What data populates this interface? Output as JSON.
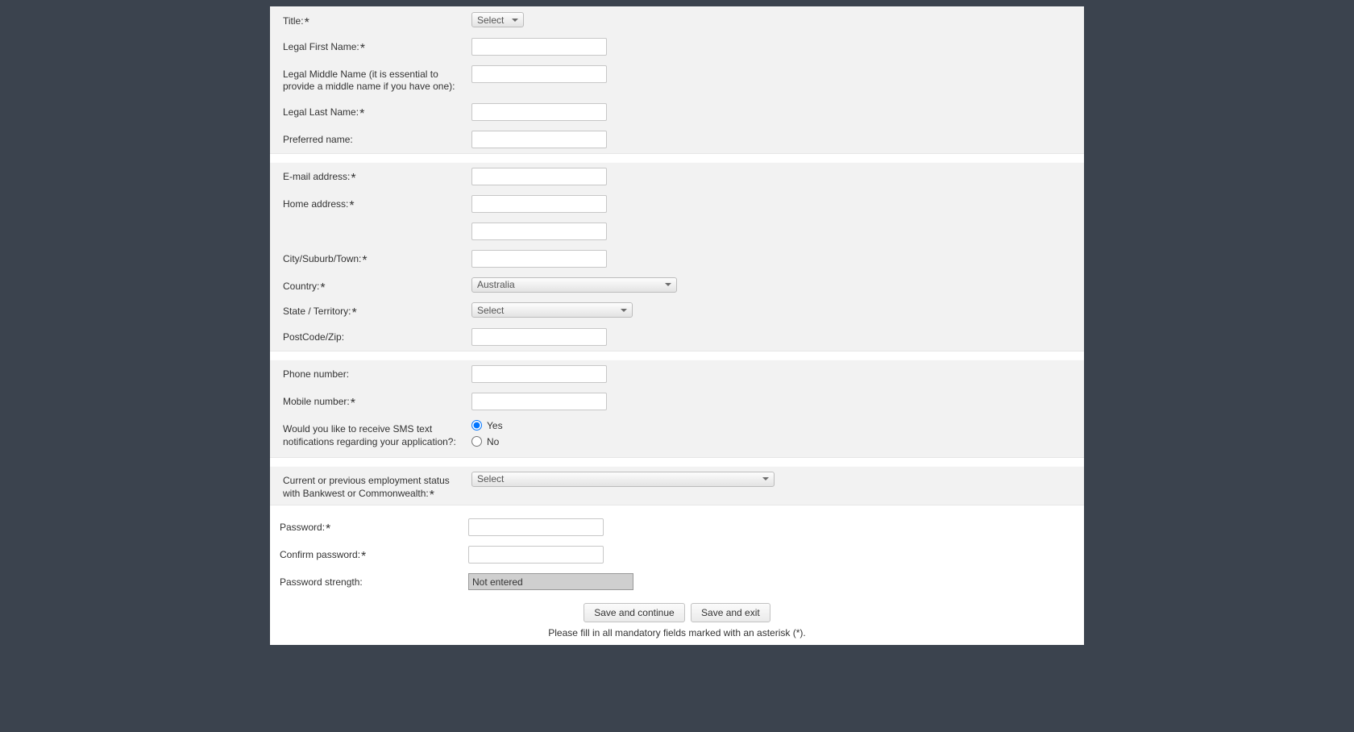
{
  "personal": {
    "title_label": "Title:",
    "title_value": "Select",
    "first_name_label": "Legal First Name:",
    "first_name_value": "",
    "middle_name_label": "Legal Middle Name (it is essential to provide a middle name if you have one):",
    "middle_name_value": "",
    "last_name_label": "Legal Last Name:",
    "last_name_value": "",
    "preferred_label": "Preferred name:",
    "preferred_value": ""
  },
  "address": {
    "email_label": "E-mail address:",
    "email_value": "",
    "home_label": "Home address:",
    "home_value1": "",
    "home_value2": "",
    "city_label": "City/Suburb/Town:",
    "city_value": "",
    "country_label": "Country:",
    "country_value": "Australia",
    "state_label": "State / Territory:",
    "state_value": "Select",
    "postcode_label": "PostCode/Zip:",
    "postcode_value": ""
  },
  "contact": {
    "phone_label": "Phone number:",
    "phone_value": "",
    "mobile_label": "Mobile number:",
    "mobile_value": "",
    "sms_label": "Would you like to receive SMS text notifications regarding your application?:",
    "sms_yes": "Yes",
    "sms_no": "No"
  },
  "employment": {
    "status_label": "Current or previous employment status with Bankwest or Commonwealth:",
    "status_value": "Select"
  },
  "password": {
    "label": "Password:",
    "value": "",
    "confirm_label": "Confirm password:",
    "confirm_value": "",
    "strength_label": "Password strength:",
    "strength_value": "Not entered"
  },
  "buttons": {
    "save_continue": "Save and continue",
    "save_exit": "Save and exit"
  },
  "footer": {
    "mandatory_note": "Please fill in all mandatory fields marked with an asterisk (*)."
  }
}
